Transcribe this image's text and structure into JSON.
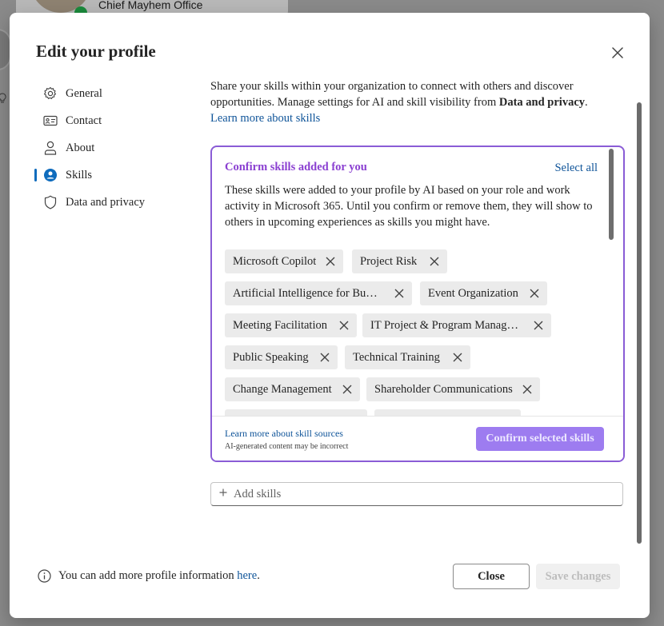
{
  "background": {
    "profile_title": "Chief Mayhem Office"
  },
  "modal": {
    "title": "Edit your profile"
  },
  "nav": {
    "items": [
      {
        "label": "General",
        "icon": "gear-icon"
      },
      {
        "label": "Contact",
        "icon": "contact-card-icon"
      },
      {
        "label": "About",
        "icon": "person-icon"
      },
      {
        "label": "Skills",
        "icon": "skills-icon",
        "active": true
      },
      {
        "label": "Data and privacy",
        "icon": "shield-icon"
      }
    ]
  },
  "intro": {
    "text": "Share your skills within your organization to connect with others and discover opportunities. Manage settings for AI and skill visibility from ",
    "bold": "Data and privacy",
    "end": ".",
    "link": "Learn more about skills"
  },
  "suggestions": {
    "title": "Confirm skills added for you",
    "select_all": "Select all",
    "description": "These skills were added to your profile by AI based on your role and work activity in Microsoft 365. Until you confirm or remove them, they will show to others in upcoming experiences as skills you might have.",
    "chips": [
      "Microsoft Copilot",
      "Project Risk",
      "Artificial Intelligence for Busi…",
      "Event Organization",
      "Meeting Facilitation",
      "IT Project & Program Manage…",
      "Public Speaking",
      "Technical Training",
      "Change Management",
      "Shareholder Communications"
    ],
    "footer_link": "Learn more about skill sources",
    "footer_note": "AI-generated content may be incorrect",
    "confirm_label": "Confirm selected skills"
  },
  "add_skills": {
    "placeholder": "Add skills"
  },
  "footer": {
    "info_text": "You can add more profile information ",
    "info_link": "here",
    "info_end": ".",
    "close_label": "Close",
    "save_label": "Save changes"
  },
  "colors": {
    "accent": "#0f6cbd",
    "ai_purple": "#8a3fd1",
    "card_border": "#8a5cd6",
    "confirm_button": "#9d7cf0"
  }
}
